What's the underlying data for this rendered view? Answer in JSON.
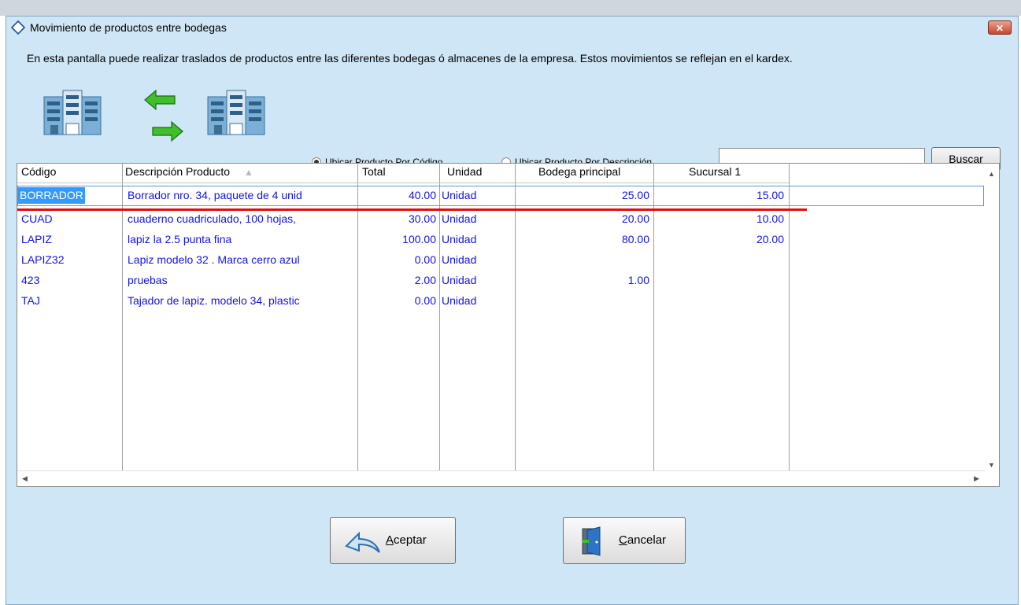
{
  "window": {
    "title": "Movimiento de productos entre bodegas",
    "close_label": "✕"
  },
  "description": "En esta pantalla puede realizar traslados de productos entre las diferentes bodegas ó almacenes de la empresa.  Estos movimientos se reflejan en el kardex.",
  "search": {
    "option_code": "Ubicar Producto Por Código",
    "option_desc": "Ubicar Producto Por Descripción",
    "selected": "code",
    "value": "",
    "button_label": "Buscar"
  },
  "table": {
    "columns": [
      "Código",
      "Descripción Producto",
      "Total",
      "Unidad",
      "Bodega principal",
      "Sucursal 1"
    ],
    "sort_indicator": "▲",
    "rows": [
      {
        "code": "BORRADOR",
        "desc": "Borrador nro. 34, paquete de 4 unid",
        "total": "40.00",
        "unit": "Unidad",
        "bodega": "25.00",
        "sucursal": "15.00"
      },
      {
        "code": "CUAD",
        "desc": "cuaderno cuadriculado, 100 hojas,",
        "total": "30.00",
        "unit": "Unidad",
        "bodega": "20.00",
        "sucursal": "10.00"
      },
      {
        "code": "LAPIZ",
        "desc": "lapiz la 2.5 punta fina",
        "total": "100.00",
        "unit": "Unidad",
        "bodega": "80.00",
        "sucursal": "20.00"
      },
      {
        "code": "LAPIZ32",
        "desc": "Lapiz modelo 32 . Marca cerro azul",
        "total": "0.00",
        "unit": "Unidad",
        "bodega": "",
        "sucursal": ""
      },
      {
        "code": "423",
        "desc": "pruebas",
        "total": "2.00",
        "unit": "Unidad",
        "bodega": "1.00",
        "sucursal": ""
      },
      {
        "code": "TAJ",
        "desc": "Tajador de lapiz. modelo 34, plastic",
        "total": "0.00",
        "unit": "Unidad",
        "bodega": "",
        "sucursal": ""
      }
    ]
  },
  "buttons": {
    "accept": "Aceptar",
    "cancel": "Cancelar"
  },
  "colors": {
    "window_bg": "#cfe6f6",
    "cell_text": "#1212e6",
    "selection": "#3399ff",
    "annotation_line": "#e01010"
  },
  "icons": [
    "warehouse-left-icon",
    "arrow-left-icon",
    "arrow-right-icon",
    "warehouse-right-icon",
    "accept-icon",
    "exit-door-icon"
  ]
}
